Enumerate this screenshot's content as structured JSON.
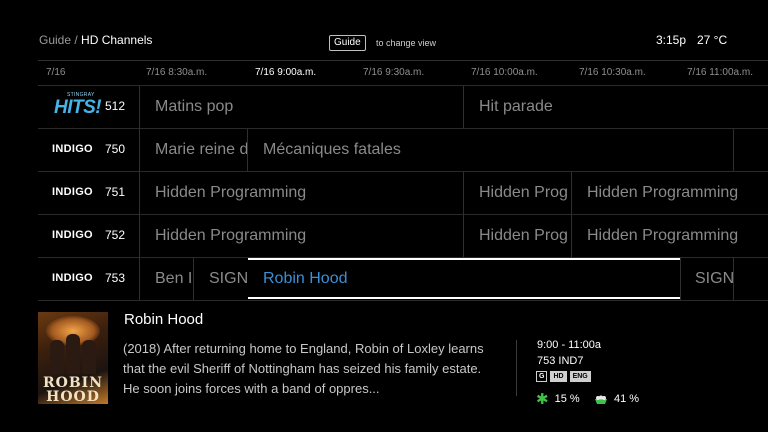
{
  "header": {
    "breadcrumb_root": "Guide /",
    "breadcrumb_current": "HD Channels",
    "guide_key": "Guide",
    "guide_hint": "to change view",
    "clock": "3:15p",
    "weather": "27 °C"
  },
  "timebar": {
    "date": "7/16",
    "slots": [
      "7/16 8:30a.m.",
      "7/16 9:00a.m.",
      "7/16 9:30a.m.",
      "7/16 10:00a.m.",
      "7/16 10:30a.m.",
      "7/16 11:00a.m."
    ],
    "current_slot": "7/16 9:00a.m."
  },
  "channels": [
    {
      "logo": "HITS!",
      "logo_sub": "STINGRAY",
      "number": "512",
      "programs": [
        "Matins pop",
        "Hit parade"
      ]
    },
    {
      "logo": "INDIGO",
      "number": "750",
      "programs": [
        "Marie reine d",
        "Mécaniques fatales"
      ]
    },
    {
      "logo": "INDIGO",
      "number": "751",
      "programs": [
        "Hidden Programming",
        "Hidden Prog",
        "Hidden Programming"
      ]
    },
    {
      "logo": "INDIGO",
      "number": "752",
      "programs": [
        "Hidden Programming",
        "Hidden Prog",
        "Hidden Programming"
      ]
    },
    {
      "logo": "INDIGO",
      "number": "753",
      "programs": [
        "Ben Is",
        "SIGN",
        "Robin Hood",
        "SIGN"
      ]
    }
  ],
  "selected": {
    "title": "Robin Hood",
    "description": "(2018) After returning home to England, Robin of Loxley learns that the evil Sheriff of Nottingham has seized his family estate. He soon joins forces with a band of oppres...",
    "poster_title_top": "ROBIN",
    "poster_title_bottom": "HOOD",
    "timeslot": "9:00 - 11:00a",
    "channel_code": "753 IND7",
    "badges": [
      "G",
      "HD",
      "ENG"
    ],
    "critic_rating": "15 %",
    "audience_rating": "41 %"
  },
  "colors": {
    "background": "#000000",
    "selected_text": "#3a8fd6",
    "hits_logo": "#46b4e6",
    "rating_star": "#3ec34a"
  }
}
